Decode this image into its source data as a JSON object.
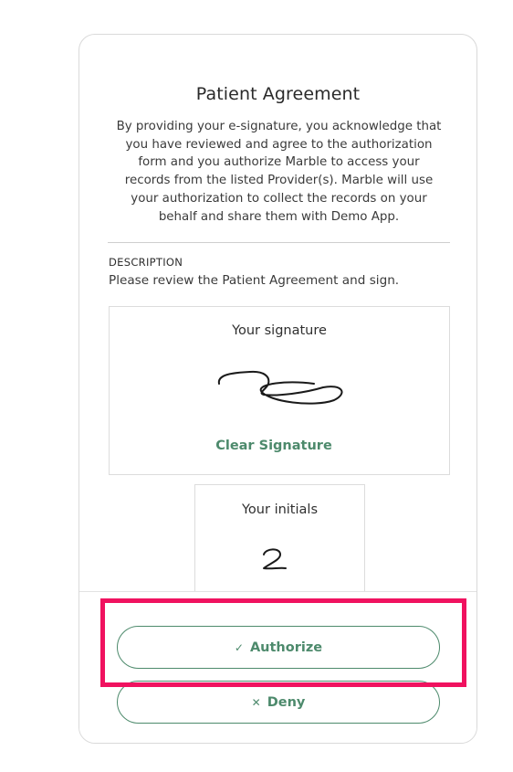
{
  "agreement": {
    "title": "Patient Agreement",
    "intro_lines": [
      "By providing your e-signature, you acknowledge that",
      "you have reviewed and agree to the authorization",
      "form and you authorize Marble to access your",
      "records from the listed Provider(s). Marble will use",
      "your authorization to collect the records on your",
      "behalf and share them with Demo App."
    ],
    "description_heading": "DESCRIPTION",
    "description_text": "Please review the Patient Agreement and sign."
  },
  "signature": {
    "label": "Your signature",
    "clear_label": "Clear Signature"
  },
  "initials": {
    "label": "Your initials"
  },
  "actions": {
    "authorize_label": "Authorize",
    "authorize_icon": "check-icon",
    "deny_label": "Deny",
    "deny_icon": "x-icon"
  },
  "colors": {
    "accent": "#4d8a6c",
    "highlight": "#f0125f"
  }
}
